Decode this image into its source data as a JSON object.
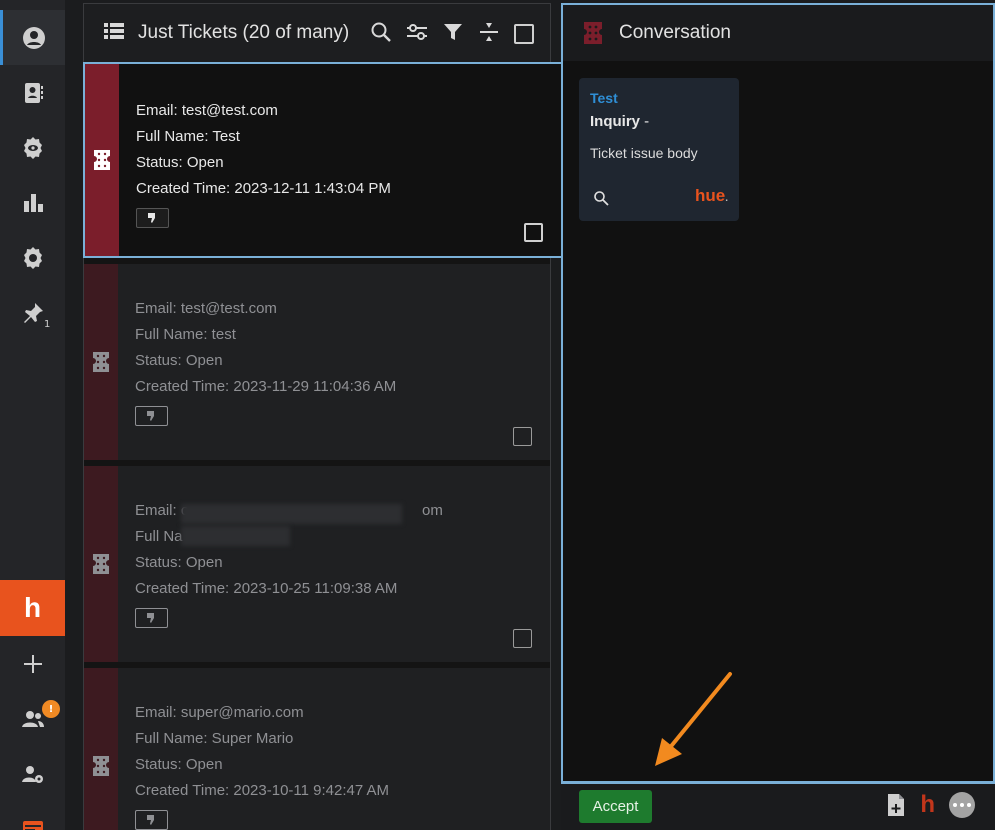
{
  "rail": {
    "pin_count": "1",
    "brand_letter": "h",
    "notify_count": "!"
  },
  "tickets": {
    "title": "Just Tickets (20 of many)",
    "items": [
      {
        "email": "Email: test@test.com",
        "name": "Full Name: Test",
        "status": "Status: Open",
        "created": "Created Time: 2023-12-11 1:43:04 PM"
      },
      {
        "email": "Email: test@test.com",
        "name": "Full Name: test",
        "status": "Status: Open",
        "created": "Created Time: 2023-11-29 11:04:36 AM"
      },
      {
        "email": "Email: c",
        "email_tail": "om",
        "name": "Full Na",
        "status": "Status: Open",
        "created": "Created Time: 2023-10-25 11:09:38 AM"
      },
      {
        "email": "Email: super@mario.com",
        "name": "Full Name: Super Mario",
        "status": "Status: Open",
        "created": "Created Time: 2023-10-11 9:42:47 AM"
      }
    ]
  },
  "conversation": {
    "title": "Conversation",
    "card": {
      "sender": "Test",
      "subject_bold": "Inquiry",
      "subject_rest": " -",
      "body": "Ticket issue body",
      "brand": "hue",
      "brand_dot": "."
    },
    "accept_label": "Accept",
    "footer_brand": "h"
  },
  "colors": {
    "accent_orange": "#e8531e",
    "selection_blue": "#7ab0d8",
    "ticket_stripe": "#7b1e2b",
    "accept_green": "#1e7b2e",
    "link_blue": "#2f8fd6"
  }
}
